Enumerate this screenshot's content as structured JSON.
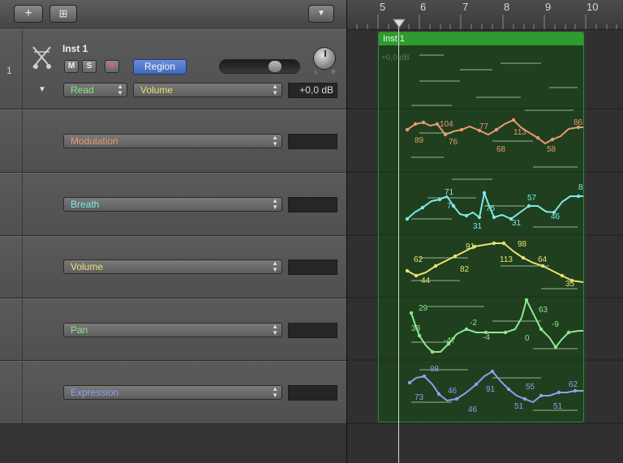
{
  "toolbar": {
    "add_label": "+",
    "folder_label": "⊞",
    "menu_label": "▼"
  },
  "ruler": {
    "bars": [
      "5",
      "6",
      "7",
      "8",
      "9",
      "10"
    ]
  },
  "main_track": {
    "number": "1",
    "name": "Inst 1",
    "mute": "M",
    "solo": "S",
    "record": "R",
    "region_button": "Region",
    "automation_mode": "Read",
    "parameter": "Volume",
    "value": "+0,0 dB",
    "pan_l": "L",
    "pan_r": "R"
  },
  "lanes": [
    {
      "parameter": "Modulation",
      "value": "",
      "color": "#e69a70"
    },
    {
      "parameter": "Breath",
      "value": "",
      "color": "#7fe8e8"
    },
    {
      "parameter": "Volume",
      "value": "",
      "color": "#ece070"
    },
    {
      "parameter": "Pan",
      "value": "",
      "color": "#8ee88e"
    },
    {
      "parameter": "Expression",
      "value": "",
      "color": "#8ea0ee"
    }
  ],
  "region": {
    "name": "Inst 1",
    "overlay_value": "+0,0 dB"
  },
  "automation": [
    {
      "color": "#e69a70",
      "labels": [
        "104",
        "77",
        "113",
        "86",
        "89",
        "76",
        "68",
        "58"
      ]
    },
    {
      "color": "#7fe8e8",
      "labels": [
        "71",
        "7",
        "75",
        "57",
        "8",
        "31",
        "31",
        "46"
      ]
    },
    {
      "color": "#ece070",
      "labels": [
        "91",
        "98",
        "62",
        "82",
        "113",
        "64",
        "44",
        "35"
      ]
    },
    {
      "color": "#8ee88e",
      "labels": [
        "29",
        "63",
        "-2",
        "33",
        "-9",
        "-4",
        "-47",
        "0"
      ]
    },
    {
      "color": "#8ea0ee",
      "labels": [
        "98",
        "62",
        "46",
        "91",
        "55",
        "73",
        "46",
        "51",
        "51"
      ]
    }
  ]
}
